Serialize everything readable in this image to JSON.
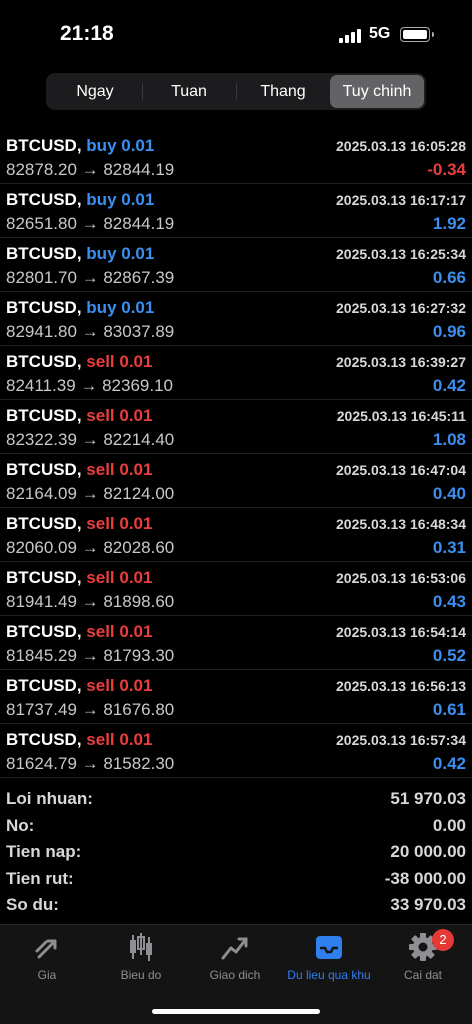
{
  "status": {
    "time": "21:18",
    "network": "5G"
  },
  "period_tabs": [
    {
      "label": "Ngay",
      "active": false
    },
    {
      "label": "Tuan",
      "active": false
    },
    {
      "label": "Thang",
      "active": false
    },
    {
      "label": "Tuy chinh",
      "active": true
    }
  ],
  "deals": [
    {
      "symbol": "BTCUSD,",
      "action": "buy 0.01",
      "side": "buy",
      "datetime": "2025.03.13 16:05:28",
      "prices": "82878.20 → 82844.19",
      "profit": "-0.34"
    },
    {
      "symbol": "BTCUSD,",
      "action": "buy 0.01",
      "side": "buy",
      "datetime": "2025.03.13 16:17:17",
      "prices": "82651.80 → 82844.19",
      "profit": "1.92"
    },
    {
      "symbol": "BTCUSD,",
      "action": "buy 0.01",
      "side": "buy",
      "datetime": "2025.03.13 16:25:34",
      "prices": "82801.70 → 82867.39",
      "profit": "0.66"
    },
    {
      "symbol": "BTCUSD,",
      "action": "buy 0.01",
      "side": "buy",
      "datetime": "2025.03.13 16:27:32",
      "prices": "82941.80 → 83037.89",
      "profit": "0.96"
    },
    {
      "symbol": "BTCUSD,",
      "action": "sell 0.01",
      "side": "sell",
      "datetime": "2025.03.13 16:39:27",
      "prices": "82411.39 → 82369.10",
      "profit": "0.42"
    },
    {
      "symbol": "BTCUSD,",
      "action": "sell 0.01",
      "side": "sell",
      "datetime": "2025.03.13 16:45:11",
      "prices": "82322.39 → 82214.40",
      "profit": "1.08"
    },
    {
      "symbol": "BTCUSD,",
      "action": "sell 0.01",
      "side": "sell",
      "datetime": "2025.03.13 16:47:04",
      "prices": "82164.09 → 82124.00",
      "profit": "0.40"
    },
    {
      "symbol": "BTCUSD,",
      "action": "sell 0.01",
      "side": "sell",
      "datetime": "2025.03.13 16:48:34",
      "prices": "82060.09 → 82028.60",
      "profit": "0.31"
    },
    {
      "symbol": "BTCUSD,",
      "action": "sell 0.01",
      "side": "sell",
      "datetime": "2025.03.13 16:53:06",
      "prices": "81941.49 → 81898.60",
      "profit": "0.43"
    },
    {
      "symbol": "BTCUSD,",
      "action": "sell 0.01",
      "side": "sell",
      "datetime": "2025.03.13 16:54:14",
      "prices": "81845.29 → 81793.30",
      "profit": "0.52"
    },
    {
      "symbol": "BTCUSD,",
      "action": "sell 0.01",
      "side": "sell",
      "datetime": "2025.03.13 16:56:13",
      "prices": "81737.49 → 81676.80",
      "profit": "0.61"
    },
    {
      "symbol": "BTCUSD,",
      "action": "sell 0.01",
      "side": "sell",
      "datetime": "2025.03.13 16:57:34",
      "prices": "81624.79 → 81582.30",
      "profit": "0.42"
    }
  ],
  "summary": [
    {
      "label": "Loi nhuan:",
      "value": "51 970.03"
    },
    {
      "label": "No:",
      "value": "0.00"
    },
    {
      "label": "Tien nap:",
      "value": "20 000.00"
    },
    {
      "label": "Tien rut:",
      "value": "-38 000.00"
    },
    {
      "label": "So du:",
      "value": "33 970.03"
    }
  ],
  "tabbar": [
    {
      "label": "Gia",
      "icon": "price-arrows-icon",
      "active": false
    },
    {
      "label": "Bieu do",
      "icon": "candlestick-chart-icon",
      "active": false
    },
    {
      "label": "Giao dich",
      "icon": "trade-line-icon",
      "active": false
    },
    {
      "label": "Du lieu qua khu",
      "icon": "history-inbox-icon",
      "active": true
    },
    {
      "label": "Cai dat",
      "icon": "gear-icon",
      "active": false,
      "badge": "2"
    }
  ],
  "colors": {
    "buy": "#3b8ff0",
    "sell": "#ea3d3d",
    "active_tab": "#2f7fef",
    "badge": "#e53935"
  }
}
